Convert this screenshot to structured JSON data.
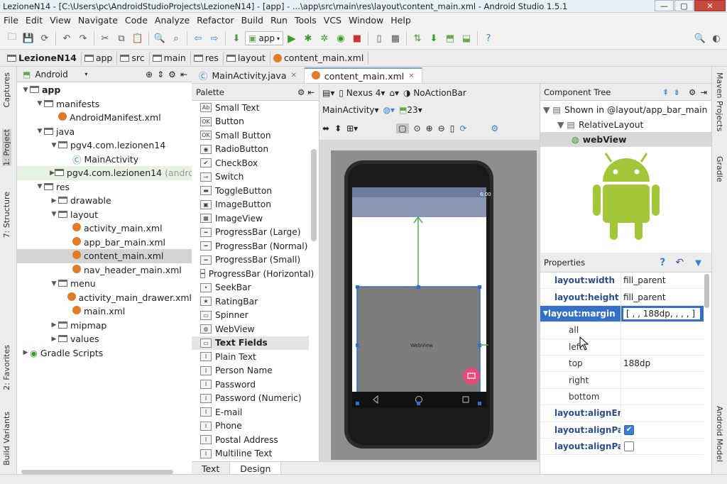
{
  "window": {
    "title": "LezioneN14 - [C:\\Users\\pc\\AndroidStudioProjects\\LezioneN14] - [app] - ...\\app\\src\\main\\res\\layout\\content_main.xml - Android Studio 1.5.1",
    "min": "—",
    "max": "▢",
    "close": "✕"
  },
  "menu": [
    "File",
    "Edit",
    "View",
    "Navigate",
    "Code",
    "Analyze",
    "Refactor",
    "Build",
    "Run",
    "Tools",
    "VCS",
    "Window",
    "Help"
  ],
  "toolbar": {
    "app_config": "app"
  },
  "breadcrumb": [
    "LezioneN14",
    "app",
    "src",
    "main",
    "res",
    "layout",
    "content_main.xml"
  ],
  "left_tabs": {
    "captures": "Captures",
    "project": "1: Project",
    "structure": "7: Structure",
    "favorites": "2: Favorites",
    "build_variants": "Build Variants"
  },
  "right_tabs": {
    "maven": "Maven Projects",
    "gradle": "Gradle",
    "android_model": "Android Model"
  },
  "project": {
    "view_mode": "Android",
    "tree": [
      {
        "label": "app",
        "depth": 0,
        "icon": "folder",
        "bold": true,
        "arrow": "open"
      },
      {
        "label": "manifests",
        "depth": 1,
        "icon": "folder",
        "arrow": "open"
      },
      {
        "label": "AndroidManifest.xml",
        "depth": 2,
        "icon": "xml",
        "arrow": ""
      },
      {
        "label": "java",
        "depth": 1,
        "icon": "folder",
        "arrow": "open"
      },
      {
        "label": "pgv4.com.lezionen14",
        "depth": 2,
        "icon": "folder",
        "arrow": "open"
      },
      {
        "label": "MainActivity",
        "depth": 3,
        "icon": "class",
        "arrow": ""
      },
      {
        "label": "pgv4.com.lezionen14",
        "suffix": "(androidT",
        "depth": 2,
        "icon": "folder",
        "arrow": "closed",
        "hl": true
      },
      {
        "label": "res",
        "depth": 1,
        "icon": "folder",
        "arrow": "open"
      },
      {
        "label": "drawable",
        "depth": 2,
        "icon": "folder",
        "arrow": "closed"
      },
      {
        "label": "layout",
        "depth": 2,
        "icon": "folder",
        "arrow": "open"
      },
      {
        "label": "activity_main.xml",
        "depth": 3,
        "icon": "xml",
        "arrow": ""
      },
      {
        "label": "app_bar_main.xml",
        "depth": 3,
        "icon": "xml",
        "arrow": ""
      },
      {
        "label": "content_main.xml",
        "depth": 3,
        "icon": "xml",
        "arrow": "",
        "sel": true
      },
      {
        "label": "nav_header_main.xml",
        "depth": 3,
        "icon": "xml",
        "arrow": ""
      },
      {
        "label": "menu",
        "depth": 2,
        "icon": "folder",
        "arrow": "open"
      },
      {
        "label": "activity_main_drawer.xml",
        "depth": 3,
        "icon": "xml",
        "arrow": ""
      },
      {
        "label": "main.xml",
        "depth": 3,
        "icon": "xml",
        "arrow": ""
      },
      {
        "label": "mipmap",
        "depth": 2,
        "icon": "folder",
        "arrow": "closed"
      },
      {
        "label": "values",
        "depth": 2,
        "icon": "folder",
        "arrow": "closed"
      },
      {
        "label": "Gradle Scripts",
        "depth": 0,
        "icon": "gradle",
        "arrow": "closed"
      }
    ]
  },
  "editor_tabs": [
    {
      "label": "MainActivity.java",
      "close": "✕",
      "active": false
    },
    {
      "label": "content_main.xml",
      "close": "✕",
      "active": true
    }
  ],
  "palette": {
    "title": "Palette",
    "items": [
      {
        "label": "Small Text",
        "icon": "Ab"
      },
      {
        "label": "Button",
        "icon": "OK"
      },
      {
        "label": "Small Button",
        "icon": "OK"
      },
      {
        "label": "RadioButton",
        "icon": "◉"
      },
      {
        "label": "CheckBox",
        "icon": "✔"
      },
      {
        "label": "Switch",
        "icon": "⊸"
      },
      {
        "label": "ToggleButton",
        "icon": "▬"
      },
      {
        "label": "ImageButton",
        "icon": "▣"
      },
      {
        "label": "ImageView",
        "icon": "▦"
      },
      {
        "label": "ProgressBar (Large)",
        "icon": "━"
      },
      {
        "label": "ProgressBar (Normal)",
        "icon": "━"
      },
      {
        "label": "ProgressBar (Small)",
        "icon": "━"
      },
      {
        "label": "ProgressBar (Horizontal)",
        "icon": "━"
      },
      {
        "label": "SeekBar",
        "icon": "•"
      },
      {
        "label": "RatingBar",
        "icon": "★"
      },
      {
        "label": "Spinner",
        "icon": "▭"
      },
      {
        "label": "WebView",
        "icon": "◍"
      },
      {
        "label": "Text Fields",
        "icon": "▭",
        "group": true
      },
      {
        "label": "Plain Text",
        "icon": "I"
      },
      {
        "label": "Person Name",
        "icon": "I"
      },
      {
        "label": "Password",
        "icon": "I"
      },
      {
        "label": "Password (Numeric)",
        "icon": "I"
      },
      {
        "label": "E-mail",
        "icon": "I"
      },
      {
        "label": "Phone",
        "icon": "I"
      },
      {
        "label": "Postal Address",
        "icon": "I"
      },
      {
        "label": "Multiline Text",
        "icon": "I"
      }
    ]
  },
  "design_toolbar": {
    "device": "Nexus 4",
    "theme": "NoActionBar",
    "activity": "MainActivity",
    "api": "23"
  },
  "preview": {
    "status_time": "6:00",
    "webview_label": "WebView"
  },
  "editor_bottom_tabs": [
    {
      "label": "Text",
      "active": false
    },
    {
      "label": "Design",
      "active": true
    }
  ],
  "component_tree": {
    "title": "Component Tree",
    "rows": [
      {
        "label": "Shown in @layout/app_bar_main",
        "indent": 0
      },
      {
        "label": "RelativeLayout",
        "indent": 1
      },
      {
        "label": "webView",
        "indent": 2,
        "sel": true
      }
    ]
  },
  "properties": {
    "title": "Properties",
    "rows": [
      {
        "name": "layout:width",
        "value": "fill_parent"
      },
      {
        "name": "layout:height",
        "value": "fill_parent"
      },
      {
        "name": "layout:margin",
        "value": "[ , , 188dp, , , , ]",
        "sel": true,
        "expanded": true
      },
      {
        "name": "all",
        "value": "",
        "sub": true
      },
      {
        "name": "left",
        "value": "",
        "sub": true
      },
      {
        "name": "top",
        "value": "188dp",
        "sub": true
      },
      {
        "name": "right",
        "value": "",
        "sub": true
      },
      {
        "name": "bottom",
        "value": "",
        "sub": true
      },
      {
        "name": "layout:alignEnd",
        "value": ""
      },
      {
        "name": "layout:alignParer",
        "checkbox": true,
        "checked": true
      },
      {
        "name": "layout:alignParer",
        "checkbox": true,
        "checked": false
      }
    ]
  },
  "colors": {
    "android_green": "#a4c639",
    "selection_blue": "#3470c8",
    "fab_pink": "#e84a7a"
  }
}
